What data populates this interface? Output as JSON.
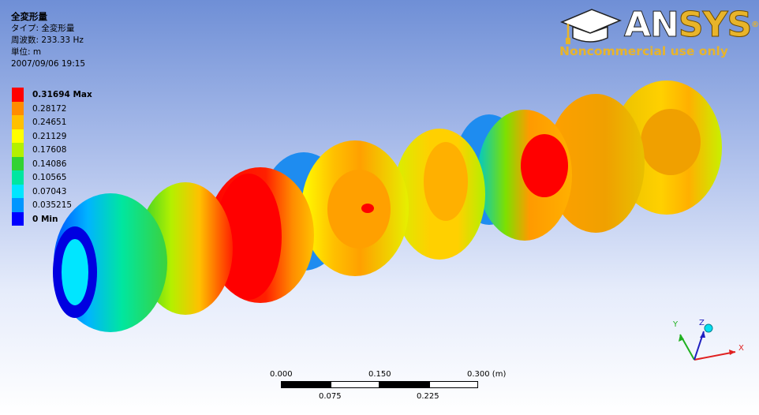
{
  "header": {
    "title": "全変形量",
    "type_line": "タイプ: 全変形量",
    "frequency_line": "周波数: 233.33 Hz",
    "unit_line": "単位: m",
    "date_line": "2007/09/06 19:15"
  },
  "legend": {
    "items": [
      {
        "label": "0.31694 Max",
        "color": "#ff0000",
        "bold": true
      },
      {
        "label": "0.28172",
        "color": "#ff8c00",
        "bold": false
      },
      {
        "label": "0.24651",
        "color": "#ffc000",
        "bold": false
      },
      {
        "label": "0.21129",
        "color": "#ffff00",
        "bold": false
      },
      {
        "label": "0.17608",
        "color": "#b4f000",
        "bold": false
      },
      {
        "label": "0.14086",
        "color": "#32d232",
        "bold": false
      },
      {
        "label": "0.10565",
        "color": "#00e6a0",
        "bold": false
      },
      {
        "label": "0.07043",
        "color": "#00e6ff",
        "bold": false
      },
      {
        "label": "0.035215",
        "color": "#0096ff",
        "bold": false
      },
      {
        "label": "0 Min",
        "color": "#0000ff",
        "bold": true
      }
    ]
  },
  "logo": {
    "brand_an": "AN",
    "brand_sys": "SYS",
    "registered": "®",
    "notice": "Noncommercial use only",
    "icon": "graduation-cap-icon"
  },
  "scale_bar": {
    "top_labels": [
      "0.000",
      "0.150",
      "0.300 (m)"
    ],
    "bottom_labels": [
      "0.075",
      "0.225"
    ]
  },
  "triad": {
    "x_label": "X",
    "y_label": "Y",
    "z_label": "Z"
  }
}
